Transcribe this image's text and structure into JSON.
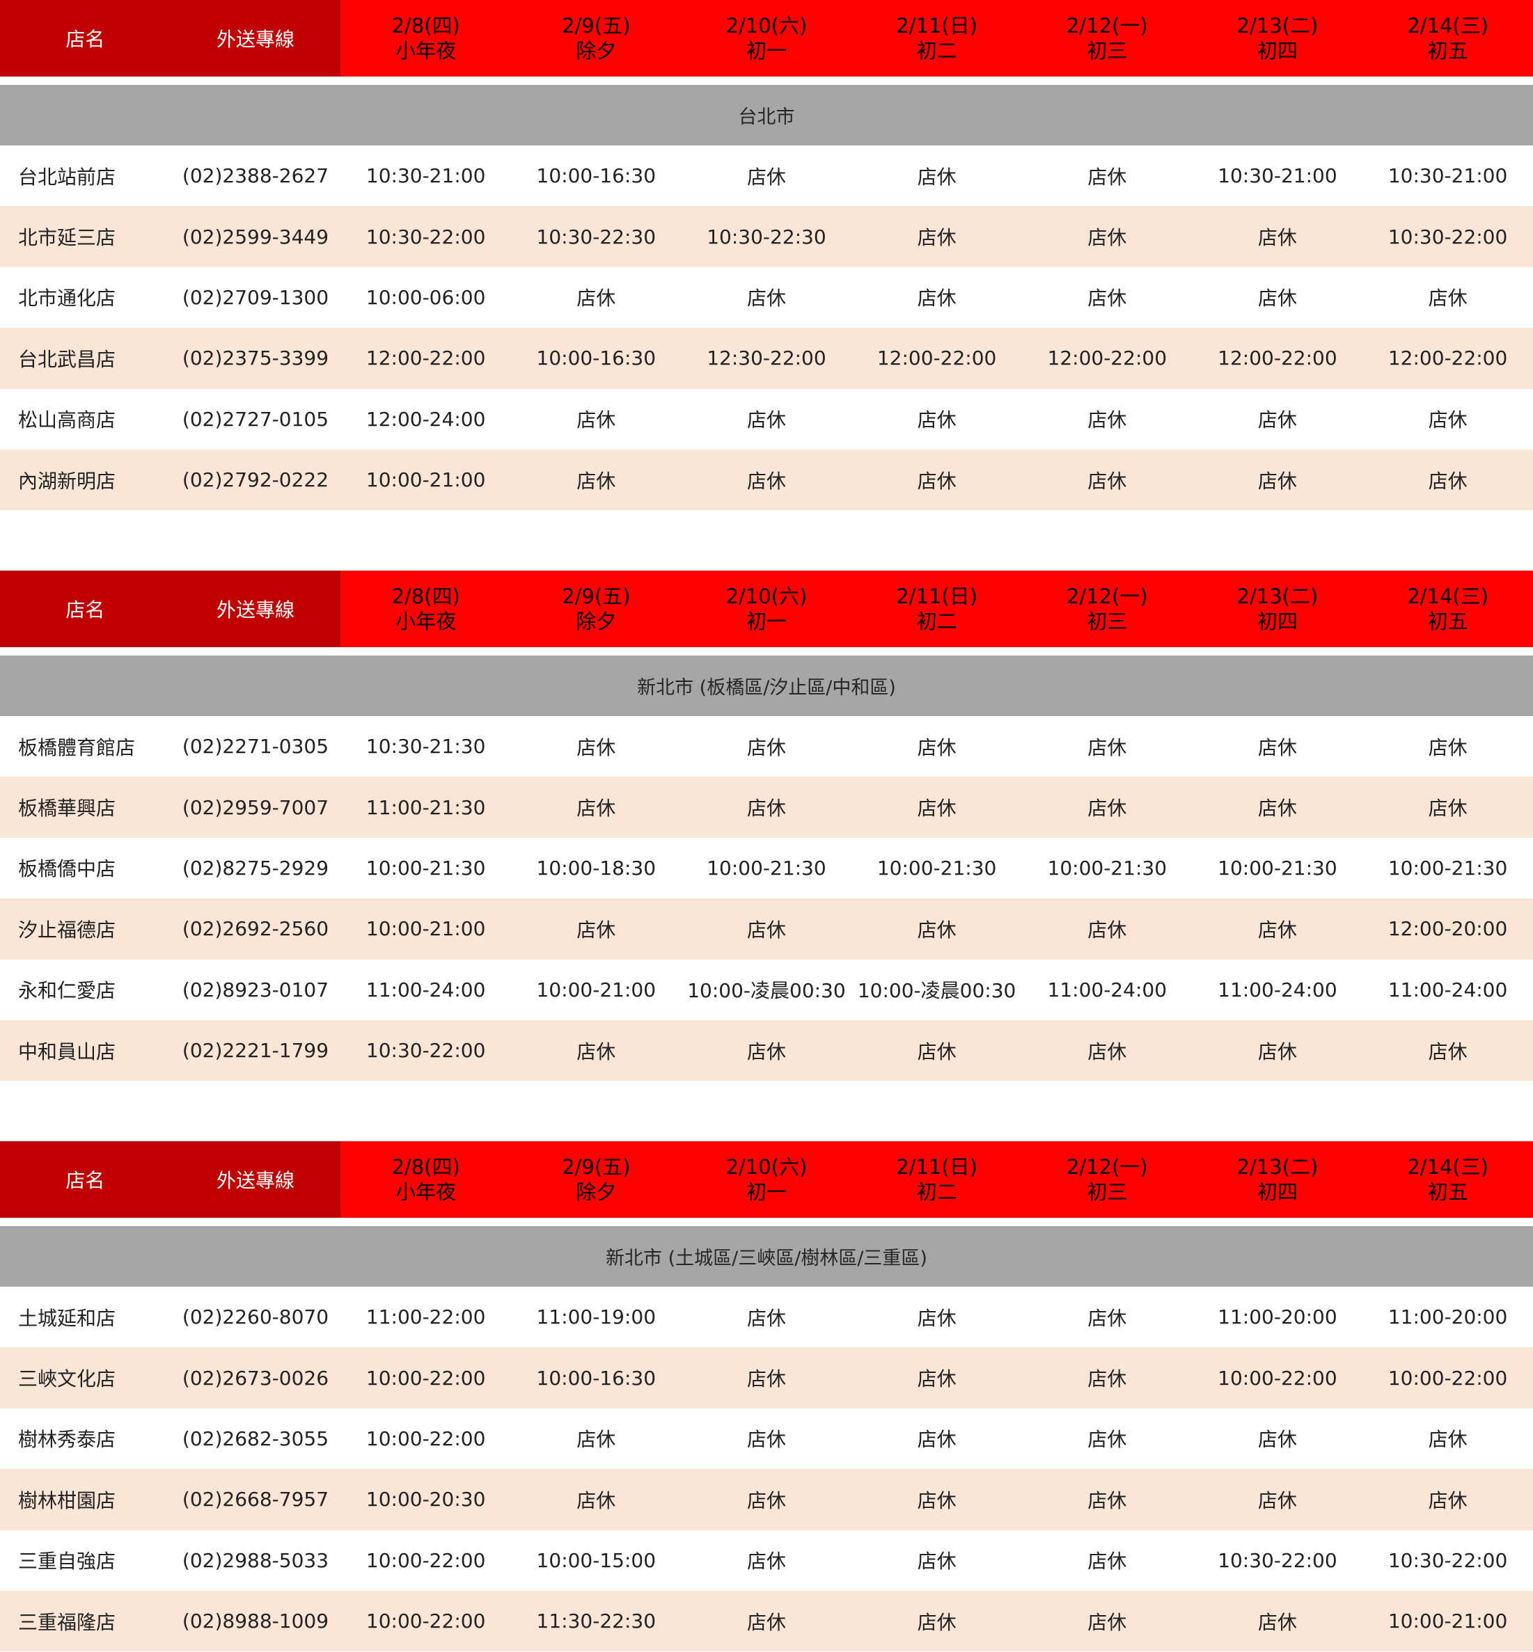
{
  "header": {
    "store_label": "店名",
    "phone_label": "外送專線",
    "dates": [
      {
        "date": "2/8(四)",
        "sub": "小年夜"
      },
      {
        "date": "2/9(五)",
        "sub": "除夕"
      },
      {
        "date": "2/10(六)",
        "sub": "初一"
      },
      {
        "date": "2/11(日)",
        "sub": "初二"
      },
      {
        "date": "2/12(一)",
        "sub": "初三"
      },
      {
        "date": "2/13(二)",
        "sub": "初四"
      },
      {
        "date": "2/14(三)",
        "sub": "初五"
      }
    ]
  },
  "colors": {
    "header_dark": "#c00000",
    "header_red": "#ff0000",
    "region_bg": "#a6a6a6",
    "alt_row_bg": "#fbe5d6"
  },
  "sections": [
    {
      "region": "台北市",
      "rows": [
        {
          "name": "台北站前店",
          "phone": "(02)2388-2627",
          "hours": [
            "10:30-21:00",
            "10:00-16:30",
            "店休",
            "店休",
            "店休",
            "10:30-21:00",
            "10:30-21:00"
          ]
        },
        {
          "name": "北市延三店",
          "phone": "(02)2599-3449",
          "hours": [
            "10:30-22:00",
            "10:30-22:30",
            "10:30-22:30",
            "店休",
            "店休",
            "店休",
            "10:30-22:00"
          ]
        },
        {
          "name": "北市通化店",
          "phone": "(02)2709-1300",
          "hours": [
            "10:00-06:00",
            "店休",
            "店休",
            "店休",
            "店休",
            "店休",
            "店休"
          ]
        },
        {
          "name": "台北武昌店",
          "phone": "(02)2375-3399",
          "hours": [
            "12:00-22:00",
            "10:00-16:30",
            "12:30-22:00",
            "12:00-22:00",
            "12:00-22:00",
            "12:00-22:00",
            "12:00-22:00"
          ]
        },
        {
          "name": "松山高商店",
          "phone": "(02)2727-0105",
          "hours": [
            "12:00-24:00",
            "店休",
            "店休",
            "店休",
            "店休",
            "店休",
            "店休"
          ]
        },
        {
          "name": "內湖新明店",
          "phone": "(02)2792-0222",
          "hours": [
            "10:00-21:00",
            "店休",
            "店休",
            "店休",
            "店休",
            "店休",
            "店休"
          ]
        }
      ]
    },
    {
      "region": "新北市 (板橋區/汐止區/中和區)",
      "rows": [
        {
          "name": "板橋體育館店",
          "phone": "(02)2271-0305",
          "hours": [
            "10:30-21:30",
            "店休",
            "店休",
            "店休",
            "店休",
            "店休",
            "店休"
          ]
        },
        {
          "name": "板橋華興店",
          "phone": "(02)2959-7007",
          "hours": [
            "11:00-21:30",
            "店休",
            "店休",
            "店休",
            "店休",
            "店休",
            "店休"
          ]
        },
        {
          "name": "板橋僑中店",
          "phone": "(02)8275-2929",
          "hours": [
            "10:00-21:30",
            "10:00-18:30",
            "10:00-21:30",
            "10:00-21:30",
            "10:00-21:30",
            "10:00-21:30",
            "10:00-21:30"
          ]
        },
        {
          "name": "汐止福德店",
          "phone": "(02)2692-2560",
          "hours": [
            "10:00-21:00",
            "店休",
            "店休",
            "店休",
            "店休",
            "店休",
            "12:00-20:00"
          ]
        },
        {
          "name": "永和仁愛店",
          "phone": "(02)8923-0107",
          "hours": [
            "11:00-24:00",
            "10:00-21:00",
            "10:00-凌晨00:30",
            "10:00-凌晨00:30",
            "11:00-24:00",
            "11:00-24:00",
            "11:00-24:00"
          ]
        },
        {
          "name": "中和員山店",
          "phone": "(02)2221-1799",
          "hours": [
            "10:30-22:00",
            "店休",
            "店休",
            "店休",
            "店休",
            "店休",
            "店休"
          ]
        }
      ]
    },
    {
      "region": "新北市 (土城區/三峽區/樹林區/三重區)",
      "rows": [
        {
          "name": "土城延和店",
          "phone": "(02)2260-8070",
          "hours": [
            "11:00-22:00",
            "11:00-19:00",
            "店休",
            "店休",
            "店休",
            "11:00-20:00",
            "11:00-20:00"
          ]
        },
        {
          "name": "三峽文化店",
          "phone": "(02)2673-0026",
          "hours": [
            "10:00-22:00",
            "10:00-16:30",
            "店休",
            "店休",
            "店休",
            "10:00-22:00",
            "10:00-22:00"
          ]
        },
        {
          "name": "樹林秀泰店",
          "phone": "(02)2682-3055",
          "hours": [
            "10:00-22:00",
            "店休",
            "店休",
            "店休",
            "店休",
            "店休",
            "店休"
          ]
        },
        {
          "name": "樹林柑園店",
          "phone": "(02)2668-7957",
          "hours": [
            "10:00-20:30",
            "店休",
            "店休",
            "店休",
            "店休",
            "店休",
            "店休"
          ]
        },
        {
          "name": "三重自強店",
          "phone": "(02)2988-5033",
          "hours": [
            "10:00-22:00",
            "10:00-15:00",
            "店休",
            "店休",
            "店休",
            "10:30-22:00",
            "10:30-22:00"
          ]
        },
        {
          "name": "三重福隆店",
          "phone": "(02)8988-1009",
          "hours": [
            "10:00-22:00",
            "11:30-22:30",
            "店休",
            "店休",
            "店休",
            "店休",
            "10:00-21:00"
          ]
        }
      ]
    }
  ]
}
